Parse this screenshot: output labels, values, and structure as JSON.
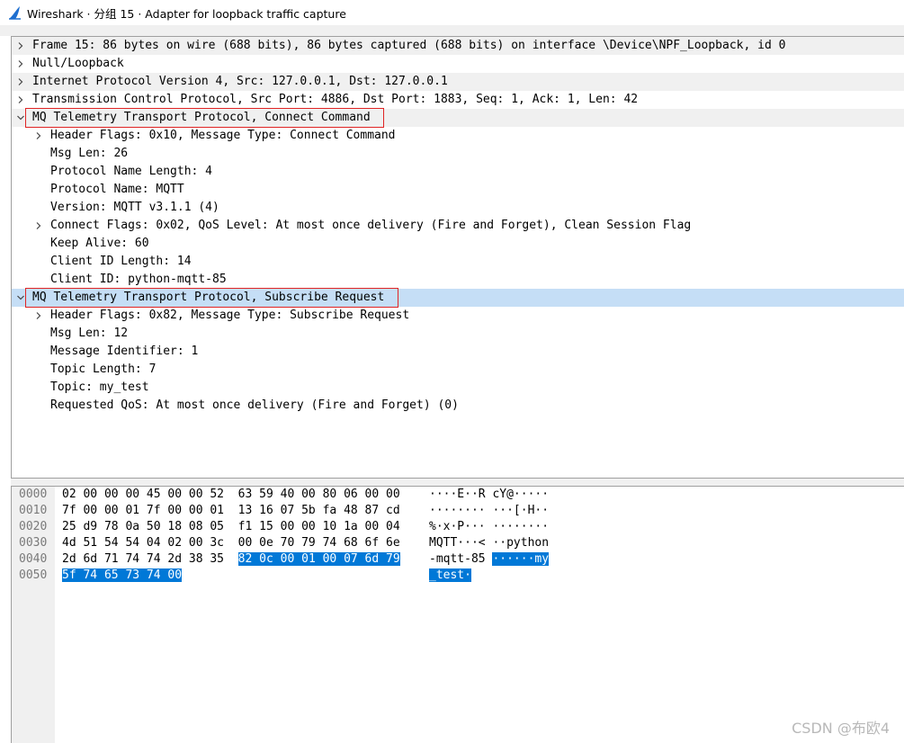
{
  "window": {
    "title": "Wireshark · 分组 15 · Adapter for loopback traffic capture"
  },
  "details": {
    "rows": [
      {
        "text": "Frame 15: 86 bytes on wire (688 bits), 86 bytes captured (688 bits) on interface \\Device\\NPF_Loopback, id 0",
        "arrow": "right",
        "level": 0,
        "shade": true
      },
      {
        "text": "Null/Loopback",
        "arrow": "right",
        "level": 0,
        "shade": false
      },
      {
        "text": "Internet Protocol Version 4, Src: 127.0.0.1, Dst: 127.0.0.1",
        "arrow": "right",
        "level": 0,
        "shade": true
      },
      {
        "text": "Transmission Control Protocol, Src Port: 4886, Dst Port: 1883, Seq: 1, Ack: 1, Len: 42",
        "arrow": "right",
        "level": 0,
        "shade": false
      },
      {
        "text": "MQ Telemetry Transport Protocol, Connect Command",
        "arrow": "down",
        "level": 0,
        "shade": true,
        "boxed": true
      },
      {
        "text": "Header Flags: 0x10, Message Type: Connect Command",
        "arrow": "right",
        "level": 1,
        "shade": false
      },
      {
        "text": "Msg Len: 26",
        "arrow": "",
        "level": 1,
        "shade": false
      },
      {
        "text": "Protocol Name Length: 4",
        "arrow": "",
        "level": 1,
        "shade": false
      },
      {
        "text": "Protocol Name: MQTT",
        "arrow": "",
        "level": 1,
        "shade": false
      },
      {
        "text": "Version: MQTT v3.1.1 (4)",
        "arrow": "",
        "level": 1,
        "shade": false
      },
      {
        "text": "Connect Flags: 0x02, QoS Level: At most once delivery (Fire and Forget), Clean Session Flag",
        "arrow": "right",
        "level": 1,
        "shade": false
      },
      {
        "text": "Keep Alive: 60",
        "arrow": "",
        "level": 1,
        "shade": false
      },
      {
        "text": "Client ID Length: 14",
        "arrow": "",
        "level": 1,
        "shade": false
      },
      {
        "text": "Client ID: python-mqtt-85",
        "arrow": "",
        "level": 1,
        "shade": false
      },
      {
        "text": "MQ Telemetry Transport Protocol, Subscribe Request",
        "arrow": "down",
        "level": 0,
        "selected": true,
        "boxed": true
      },
      {
        "text": "Header Flags: 0x82, Message Type: Subscribe Request",
        "arrow": "right",
        "level": 1,
        "shade": false
      },
      {
        "text": "Msg Len: 12",
        "arrow": "",
        "level": 1,
        "shade": false
      },
      {
        "text": "Message Identifier: 1",
        "arrow": "",
        "level": 1,
        "shade": false
      },
      {
        "text": "Topic Length: 7",
        "arrow": "",
        "level": 1,
        "shade": false
      },
      {
        "text": "Topic: my_test",
        "arrow": "",
        "level": 1,
        "shade": false
      },
      {
        "text": "Requested QoS: At most once delivery (Fire and Forget) (0)",
        "arrow": "",
        "level": 1,
        "shade": false
      }
    ]
  },
  "bytes": {
    "rows": [
      {
        "offset": "0000",
        "hex_a": "02 00 00 00 45 00 00 52  63 59 40 00 80 06 00 00",
        "hex_b": "",
        "ascii_a": "····E··R cY@·····",
        "ascii_b": ""
      },
      {
        "offset": "0010",
        "hex_a": "7f 00 00 01 7f 00 00 01  13 16 07 5b fa 48 87 cd",
        "hex_b": "",
        "ascii_a": "········ ···[·H··",
        "ascii_b": ""
      },
      {
        "offset": "0020",
        "hex_a": "25 d9 78 0a 50 18 08 05  f1 15 00 00 10 1a 00 04",
        "hex_b": "",
        "ascii_a": "%·x·P··· ········",
        "ascii_b": ""
      },
      {
        "offset": "0030",
        "hex_a": "4d 51 54 54 04 02 00 3c  00 0e 70 79 74 68 6f 6e",
        "hex_b": "",
        "ascii_a": "MQTT···< ··python",
        "ascii_b": ""
      },
      {
        "offset": "0040",
        "hex_a": "2d 6d 71 74 74 2d 38 35  ",
        "hex_b": "82 0c 00 01 00 07 6d 79",
        "ascii_a": "-mqtt-85 ",
        "ascii_b": "······my"
      },
      {
        "offset": "0050",
        "hex_a": "",
        "hex_b": "5f 74 65 73 74 00",
        "ascii_a": "",
        "ascii_b": "_test·"
      }
    ]
  },
  "watermark": "CSDN @布欧4",
  "colors": {
    "selection": "#c5def6",
    "byte_highlight": "#0078d7",
    "annotation_box": "#e02424",
    "logo": "#1e6fd0"
  }
}
